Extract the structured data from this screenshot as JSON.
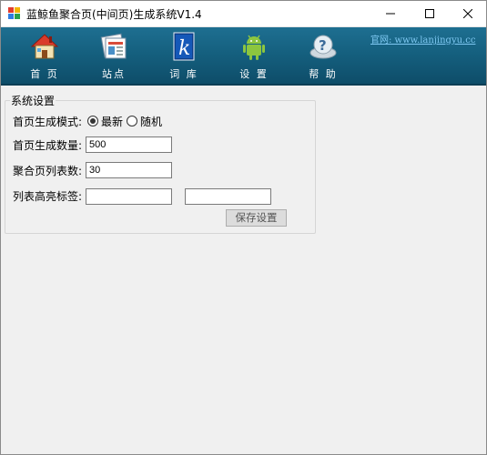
{
  "window": {
    "title": "蓝鲸鱼聚合页(中间页)生成系统V1.4"
  },
  "toolbar": {
    "items": [
      {
        "label": "首 页",
        "icon": "home-icon"
      },
      {
        "label": "站点",
        "icon": "sites-icon"
      },
      {
        "label": "词 库",
        "icon": "dictionary-icon"
      },
      {
        "label": "设 置",
        "icon": "android-icon"
      },
      {
        "label": "帮 助",
        "icon": "help-icon"
      }
    ],
    "site_link": "官网: www.lanjingyu.cc"
  },
  "settings": {
    "group_title": "系统设置",
    "mode_label": "首页生成模式:",
    "mode_options": [
      "最新",
      "随机"
    ],
    "mode_selected": "最新",
    "count_label": "首页生成数量:",
    "count_value": "500",
    "list_count_label": "聚合页列表数:",
    "list_count_value": "30",
    "highlight_label": "列表高亮标签:",
    "highlight_open_value": "",
    "highlight_close_value": "",
    "save_label": "保存设置"
  },
  "colors": {
    "toolbar_top": "#1e6f91",
    "toolbar_bottom": "#0e4d69",
    "link": "#7ec8f2"
  }
}
